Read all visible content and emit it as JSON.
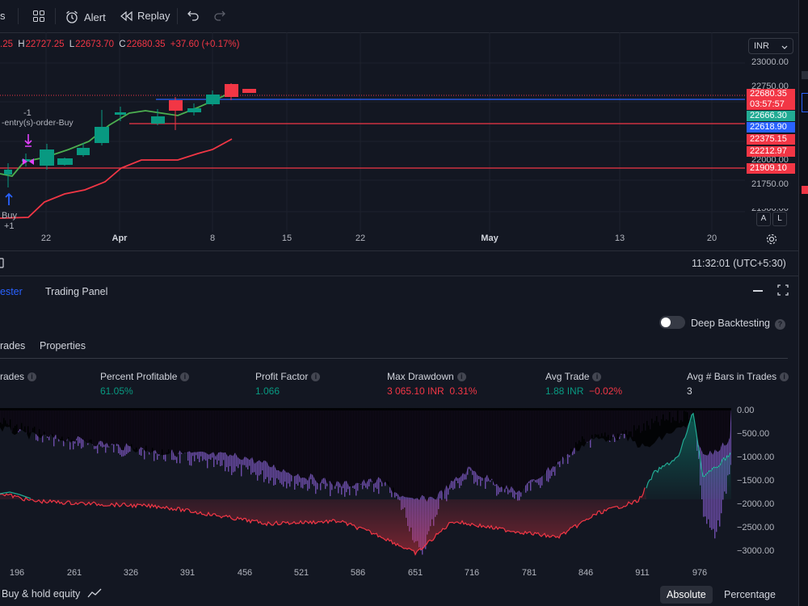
{
  "toolbar": {
    "partial_label": "s",
    "alert_label": "Alert",
    "replay_label": "Replay"
  },
  "legend": {
    "open_fragment": ".25",
    "high_label": "H",
    "high": "22727.25",
    "low_label": "L",
    "low": "22673.70",
    "close_label": "C",
    "close": "22680.35",
    "change": "+37.60 (+0.17%)"
  },
  "currency": "INR",
  "price_axis": {
    "ticks": [
      "23000.00",
      "22750.00",
      "22000.00",
      "21750.00",
      "21500.00"
    ],
    "tags": [
      {
        "text": "22680.35",
        "color": "#f23645"
      },
      {
        "text": "03:57:57",
        "color": "#f23645"
      },
      {
        "text": "22666.30",
        "color": "#22ab94"
      },
      {
        "text": "22618.90",
        "color": "#2962ff"
      },
      {
        "text": "22375.15",
        "color": "#f23645"
      },
      {
        "text": "22212.97",
        "color": "#f23645"
      },
      {
        "text": "21909.10",
        "color": "#f23645"
      }
    ]
  },
  "annotations": {
    "minus_one": "-1",
    "order_text": "-entry(s)-order-Buy",
    "buy": "Buy",
    "plus_one": "+1"
  },
  "time_axis": [
    "22",
    "Apr",
    "8",
    "15",
    "22",
    "May",
    "13",
    "20"
  ],
  "auto_scale": {
    "a": "A",
    "l": "L"
  },
  "status_time": "11:32:01 (UTC+5:30)",
  "panel": {
    "tab_strategy": "ester",
    "tab_trading": "Trading Panel"
  },
  "deep_backtesting": "Deep Backtesting",
  "sub_tabs": {
    "trades": "rades",
    "properties": "Properties"
  },
  "metrics": [
    {
      "label": "rades",
      "value": "",
      "value2": ""
    },
    {
      "label": "Percent Profitable",
      "value": "61.05%",
      "value2": ""
    },
    {
      "label": "Profit Factor",
      "value": "1.066",
      "value2": ""
    },
    {
      "label": "Max Drawdown",
      "value": "3 065.10 INR",
      "value2": "0.31%"
    },
    {
      "label": "Avg Trade",
      "value": "1.88 INR",
      "value2": "−0.02%"
    },
    {
      "label": "Avg # Bars in Trades",
      "value": "3",
      "value2": ""
    }
  ],
  "equity_axis": {
    "y_ticks": [
      "0.00",
      "−500.00",
      "−1000.00",
      "−1500.00",
      "−2000.00",
      "−2500.00",
      "−3000.00"
    ],
    "x_ticks": [
      "196",
      "261",
      "326",
      "391",
      "456",
      "521",
      "586",
      "651",
      "716",
      "781",
      "846",
      "911",
      "976"
    ]
  },
  "bottom": {
    "buy_hold": "Buy & hold equity",
    "absolute": "Absolute",
    "percentage": "Percentage"
  },
  "colors": {
    "bull": "#089981",
    "bear": "#f23645",
    "accent": "#2962ff",
    "drawdown": "#7e57c2"
  }
}
